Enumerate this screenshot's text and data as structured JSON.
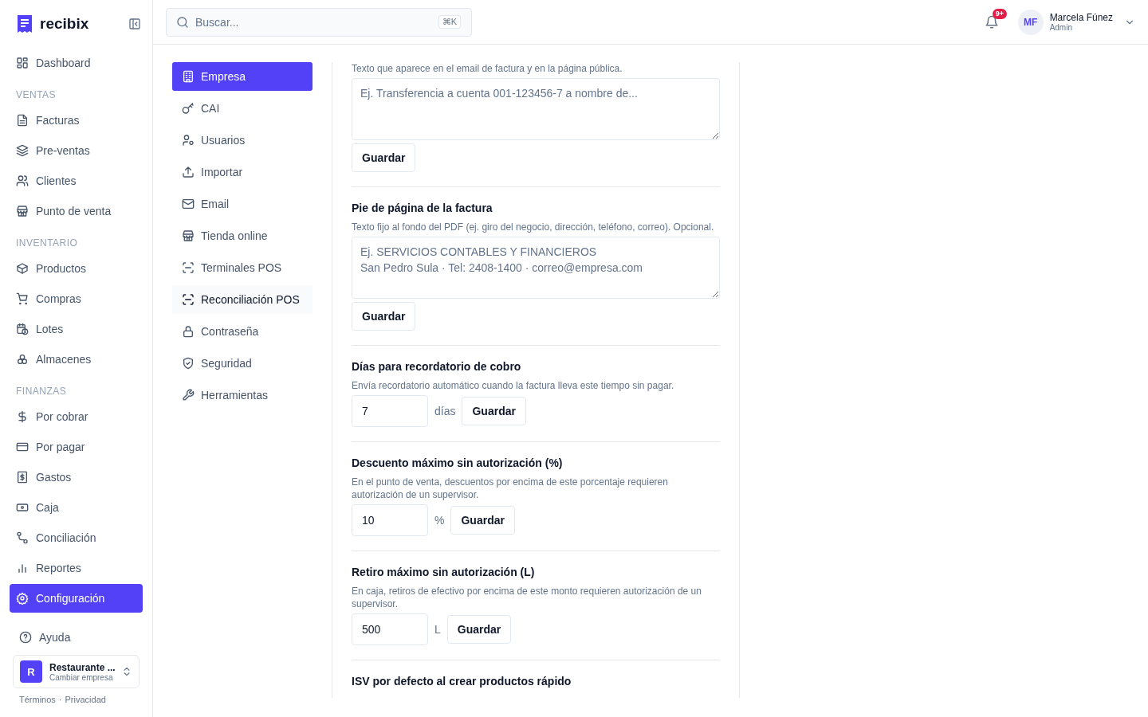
{
  "brand": {
    "name": "recibix"
  },
  "sidebar": {
    "groups": [
      {
        "items": [
          {
            "label": "Dashboard",
            "selected": false
          }
        ]
      },
      {
        "heading": "VENTAS",
        "items": [
          {
            "label": "Facturas",
            "selected": false
          },
          {
            "label": "Pre-ventas",
            "selected": false
          },
          {
            "label": "Clientes",
            "selected": false
          },
          {
            "label": "Punto de venta",
            "selected": false
          }
        ]
      },
      {
        "heading": "INVENTARIO",
        "items": [
          {
            "label": "Productos",
            "selected": false
          },
          {
            "label": "Compras",
            "selected": false
          },
          {
            "label": "Lotes",
            "selected": false
          },
          {
            "label": "Almacenes",
            "selected": false
          }
        ]
      },
      {
        "heading": "FINANZAS",
        "items": [
          {
            "label": "Por cobrar",
            "selected": false
          },
          {
            "label": "Por pagar",
            "selected": false
          },
          {
            "label": "Gastos",
            "selected": false
          },
          {
            "label": "Caja",
            "selected": false
          },
          {
            "label": "Conciliación",
            "selected": false
          },
          {
            "label": "Reportes",
            "selected": false
          },
          {
            "label": "Configuración",
            "selected": true
          }
        ]
      }
    ],
    "help": "Ayuda",
    "company": {
      "initial": "R",
      "name": "Restaurante ...",
      "action": "Cambiar empresa"
    },
    "footer_links": [
      "Términos",
      "·",
      "Privacidad"
    ]
  },
  "topbar": {
    "search": {
      "placeholder": "Buscar...",
      "shortcut": "⌘K"
    },
    "notifications": {
      "badge": "9+"
    },
    "user": {
      "initials": "MF",
      "name": "Marcela Fúnez",
      "role": "Admin"
    }
  },
  "settings_nav": [
    {
      "label": "Empresa",
      "selected": true,
      "hover": false
    },
    {
      "label": "CAI",
      "selected": false,
      "hover": false
    },
    {
      "label": "Usuarios",
      "selected": false,
      "hover": false
    },
    {
      "label": "Importar",
      "selected": false,
      "hover": false
    },
    {
      "label": "Email",
      "selected": false,
      "hover": false
    },
    {
      "label": "Tienda online",
      "selected": false,
      "hover": false
    },
    {
      "label": "Terminales POS",
      "selected": false,
      "hover": false
    },
    {
      "label": "Reconciliación POS",
      "selected": false,
      "hover": true
    },
    {
      "label": "Contraseña",
      "selected": false,
      "hover": false
    },
    {
      "label": "Seguridad",
      "selected": false,
      "hover": false
    },
    {
      "label": "Herramientas",
      "selected": false,
      "hover": false
    }
  ],
  "sections": [
    {
      "kind": "textarea",
      "description": "Texto que aparece en el email de factura y en la página pública.",
      "placeholder": "Ej. Transferencia a cuenta 001-123456-7 a nombre de...",
      "button": "Guardar"
    },
    {
      "kind": "textarea",
      "title": "Pie de página de la factura",
      "description": "Texto fijo al fondo del PDF (ej. giro del negocio, dirección, teléfono, correo). Opcional.",
      "placeholder": "Ej. SERVICIOS CONTABLES Y FINANCIEROS\nSan Pedro Sula · Tel: 2408-1400 · correo@empresa.com",
      "button": "Guardar"
    },
    {
      "kind": "number",
      "title": "Días para recordatorio de cobro",
      "description": "Envía recordatorio automático cuando la factura lleva este tiempo sin pagar.",
      "value": "7",
      "unit": "días",
      "button": "Guardar"
    },
    {
      "kind": "number",
      "title": "Descuento máximo sin autorización (%)",
      "description": "En el punto de venta, descuentos por encima de este porcentaje requieren autorización de un supervisor.",
      "value": "10",
      "unit": "%",
      "button": "Guardar"
    },
    {
      "kind": "number",
      "title": "Retiro máximo sin autorización (L)",
      "description": "En caja, retiros de efectivo por encima de este monto requieren autorización de un supervisor.",
      "value": "500",
      "unit": "L",
      "button": "Guardar"
    },
    {
      "kind": "heading",
      "title": "ISV por defecto al crear productos rápido"
    }
  ]
}
